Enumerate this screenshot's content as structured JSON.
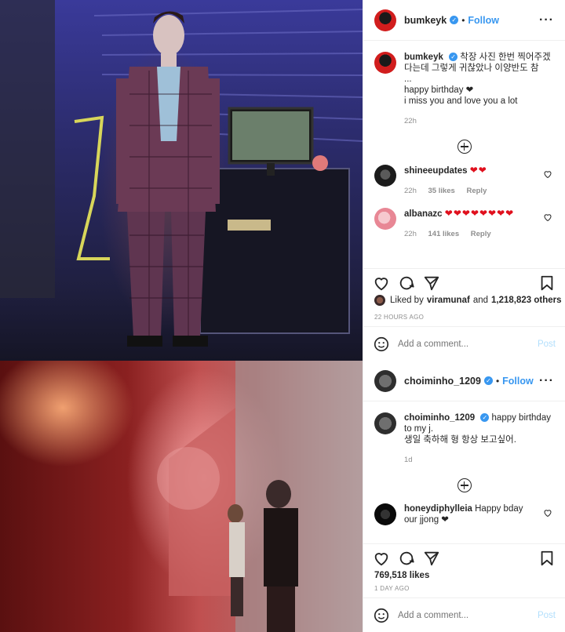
{
  "post1": {
    "photo_alt": "",
    "author": "bumkeyk",
    "follow_label": "Follow",
    "caption_lines": [
      "착장 사진 한번 찍어주겠다는데 그렇게 귀찮았나 이양반도 참",
      "...",
      "happy birthday ❤",
      "i miss you and love you a lot"
    ],
    "caption_time": "22h",
    "comments": [
      {
        "user": "shineeupdates",
        "text": "❤❤",
        "time": "22h",
        "likes": "35 likes",
        "reply": "Reply"
      },
      {
        "user": "albanazc",
        "text": "❤❤❤❤❤❤❤❤",
        "time": "22h",
        "likes": "141 likes",
        "reply": "Reply"
      }
    ],
    "liked_by_prefix": "Liked by",
    "liked_by_user": "viramunaf",
    "liked_by_and": "and",
    "liked_by_count": "1,218,823 others",
    "time_ago": "22 HOURS AGO",
    "add_comment_placeholder": "Add a comment...",
    "post_label": "Post"
  },
  "post2": {
    "author": "choiminho_1209",
    "follow_label": "Follow",
    "caption_text": "happy birthday to my j.",
    "caption_line2": "생일 축하해 형 항상 보고싶어.",
    "caption_time": "1d",
    "comments": [
      {
        "user": "honeydiphylleia",
        "text": "Happy bday our jjong ❤"
      }
    ],
    "likes": "769,518 likes",
    "time_ago": "1 DAY AGO",
    "add_comment_placeholder": "Add a comment...",
    "post_label": "Post"
  },
  "colors": {
    "link": "#3897f0",
    "heart": "#e0101d",
    "muted": "#8e8e8e",
    "post_disabled": "#b2dffc"
  }
}
